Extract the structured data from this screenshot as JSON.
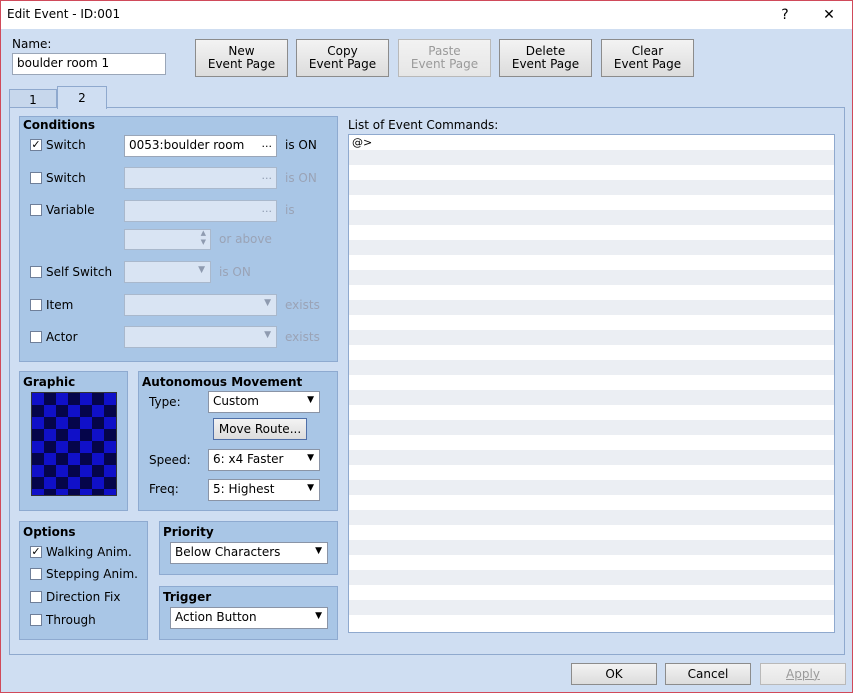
{
  "window": {
    "title": "Edit Event - ID:001",
    "help_glyph": "?",
    "close_glyph": "✕"
  },
  "name": {
    "label": "Name:",
    "value": "boulder room 1"
  },
  "toolbar": {
    "new_l1": "New",
    "new_l2": "Event Page",
    "copy_l1": "Copy",
    "copy_l2": "Event Page",
    "paste_l1": "Paste",
    "paste_l2": "Event Page",
    "delete_l1": "Delete",
    "delete_l2": "Event Page",
    "clear_l1": "Clear",
    "clear_l2": "Event Page"
  },
  "tabs": [
    {
      "label": "1",
      "active": false
    },
    {
      "label": "2",
      "active": true
    }
  ],
  "conditions": {
    "heading": "Conditions",
    "switch1": {
      "label": "Switch",
      "checked": true,
      "value": "0053:boulder room",
      "suffix": "is ON"
    },
    "switch2": {
      "label": "Switch",
      "checked": false,
      "value": "",
      "suffix": "is ON"
    },
    "variable": {
      "label": "Variable",
      "checked": false,
      "value": "",
      "suffix": "is",
      "above": "or above"
    },
    "self_switch": {
      "label": "Self Switch",
      "checked": false,
      "value": "",
      "suffix": "is ON"
    },
    "item": {
      "label": "Item",
      "checked": false,
      "value": "",
      "suffix": "exists"
    },
    "actor": {
      "label": "Actor",
      "checked": false,
      "value": "",
      "suffix": "exists"
    },
    "ellipsis": "..."
  },
  "graphic": {
    "heading": "Graphic"
  },
  "movement": {
    "heading": "Autonomous Movement",
    "type_label": "Type:",
    "type_value": "Custom",
    "move_route_button": "Move Route...",
    "speed_label": "Speed:",
    "speed_value": "6: x4 Faster",
    "freq_label": "Freq:",
    "freq_value": "5: Highest"
  },
  "options": {
    "heading": "Options",
    "walking": {
      "label": "Walking Anim.",
      "checked": true
    },
    "stepping": {
      "label": "Stepping Anim.",
      "checked": false
    },
    "direction": {
      "label": "Direction Fix",
      "checked": false
    },
    "through": {
      "label": "Through",
      "checked": false
    }
  },
  "priority": {
    "heading": "Priority",
    "value": "Below Characters"
  },
  "trigger": {
    "heading": "Trigger",
    "value": "Action Button"
  },
  "commands": {
    "heading": "List of Event Commands:",
    "items": [
      "@>"
    ]
  },
  "footer": {
    "ok": "OK",
    "cancel": "Cancel",
    "apply": "Apply"
  },
  "glyphs": {
    "check": "✓",
    "arrow_down": "▼",
    "spin_up": "▲",
    "spin_down": "▼"
  }
}
